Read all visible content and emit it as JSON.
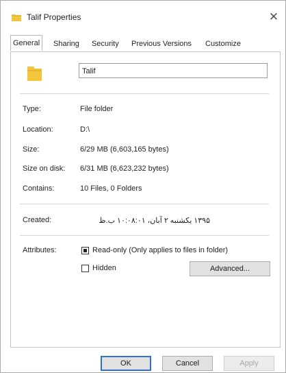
{
  "window": {
    "title": "Talif Properties",
    "close_glyph": "✕"
  },
  "tabs": [
    {
      "label": "General",
      "active": true
    },
    {
      "label": "Sharing",
      "active": false
    },
    {
      "label": "Security",
      "active": false
    },
    {
      "label": "Previous Versions",
      "active": false
    },
    {
      "label": "Customize",
      "active": false
    }
  ],
  "general": {
    "folder_icon": "folder-icon",
    "name_value": "Talif",
    "properties": [
      {
        "label": "Type:",
        "value": "File folder"
      },
      {
        "label": "Location:",
        "value": "D:\\"
      },
      {
        "label": "Size:",
        "value": "6/29 MB (6,603,165 bytes)"
      },
      {
        "label": "Size on disk:",
        "value": "6/31 MB (6,623,232 bytes)"
      },
      {
        "label": "Contains:",
        "value": "10 Files, 0 Folders"
      }
    ],
    "created": {
      "label": "Created:",
      "value": "۱۳۹۵ یکشنبه ۲ آبان، ۱۰:۰۸:۰۱ ب.ظ"
    },
    "attributes": {
      "label": "Attributes:",
      "readonly_label": "Read-only (Only applies to files in folder)",
      "readonly_state": "indeterminate",
      "hidden_label": "Hidden",
      "hidden_checked": false,
      "advanced_label": "Advanced..."
    }
  },
  "buttons": {
    "ok": "OK",
    "cancel": "Cancel",
    "apply": "Apply"
  },
  "colors": {
    "folder": "#f2c53d",
    "ok_border": "#2f6fd6"
  }
}
